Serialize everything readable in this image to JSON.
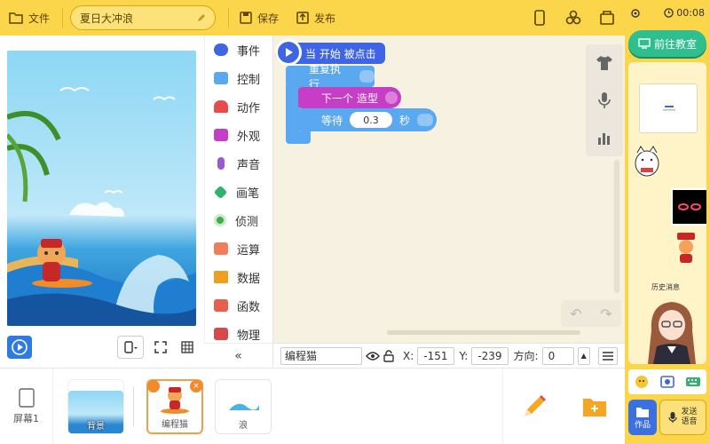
{
  "toolbar": {
    "file_label": "文件",
    "project_title": "夏日大冲浪",
    "save_label": "保存",
    "publish_label": "发布"
  },
  "right_panel": {
    "timer": "00:08",
    "classroom_label": "前往教室",
    "history_label": "历史消息",
    "works_label": "作品",
    "send_voice_label": "发送\n语音"
  },
  "categories": [
    {
      "label": "事件",
      "color": "#3f64e4"
    },
    {
      "label": "控制",
      "color": "#5aa8ef"
    },
    {
      "label": "动作",
      "color": "#e94b4b"
    },
    {
      "label": "外观",
      "color": "#c73ec6"
    },
    {
      "label": "声音",
      "color": "#9b59d0"
    },
    {
      "label": "画笔",
      "color": "#2fb36f"
    },
    {
      "label": "侦测",
      "color": "#3fae49"
    },
    {
      "label": "运算",
      "color": "#f07e5b"
    },
    {
      "label": "数据",
      "color": "#f0a020"
    },
    {
      "label": "函数",
      "color": "#e8604a"
    },
    {
      "label": "物理",
      "color": "#d84a4a"
    }
  ],
  "blocks": {
    "when_start": "当 开始 被点击",
    "repeat_forever": "重复执行",
    "next_costume": "下一个 造型",
    "wait": "等待",
    "wait_value": "0.3",
    "wait_unit": "秒"
  },
  "sprite_props": {
    "name": "编程猫",
    "x_label": "X:",
    "x_value": "-151",
    "y_label": "Y:",
    "y_value": "-239",
    "direction_label": "方向:",
    "direction_value": "0"
  },
  "sprite_bar": {
    "screen_label": "屏幕1",
    "sprites": [
      {
        "label": "背景"
      },
      {
        "label": "编程猫"
      },
      {
        "label": "浪"
      }
    ]
  },
  "colors": {
    "toolbar_yellow": "#fbd54a",
    "event_blue": "#3f64e4",
    "control_blue": "#5aa8ef",
    "looks_purple": "#c73ec6",
    "classroom_green": "#2fbf8f"
  }
}
